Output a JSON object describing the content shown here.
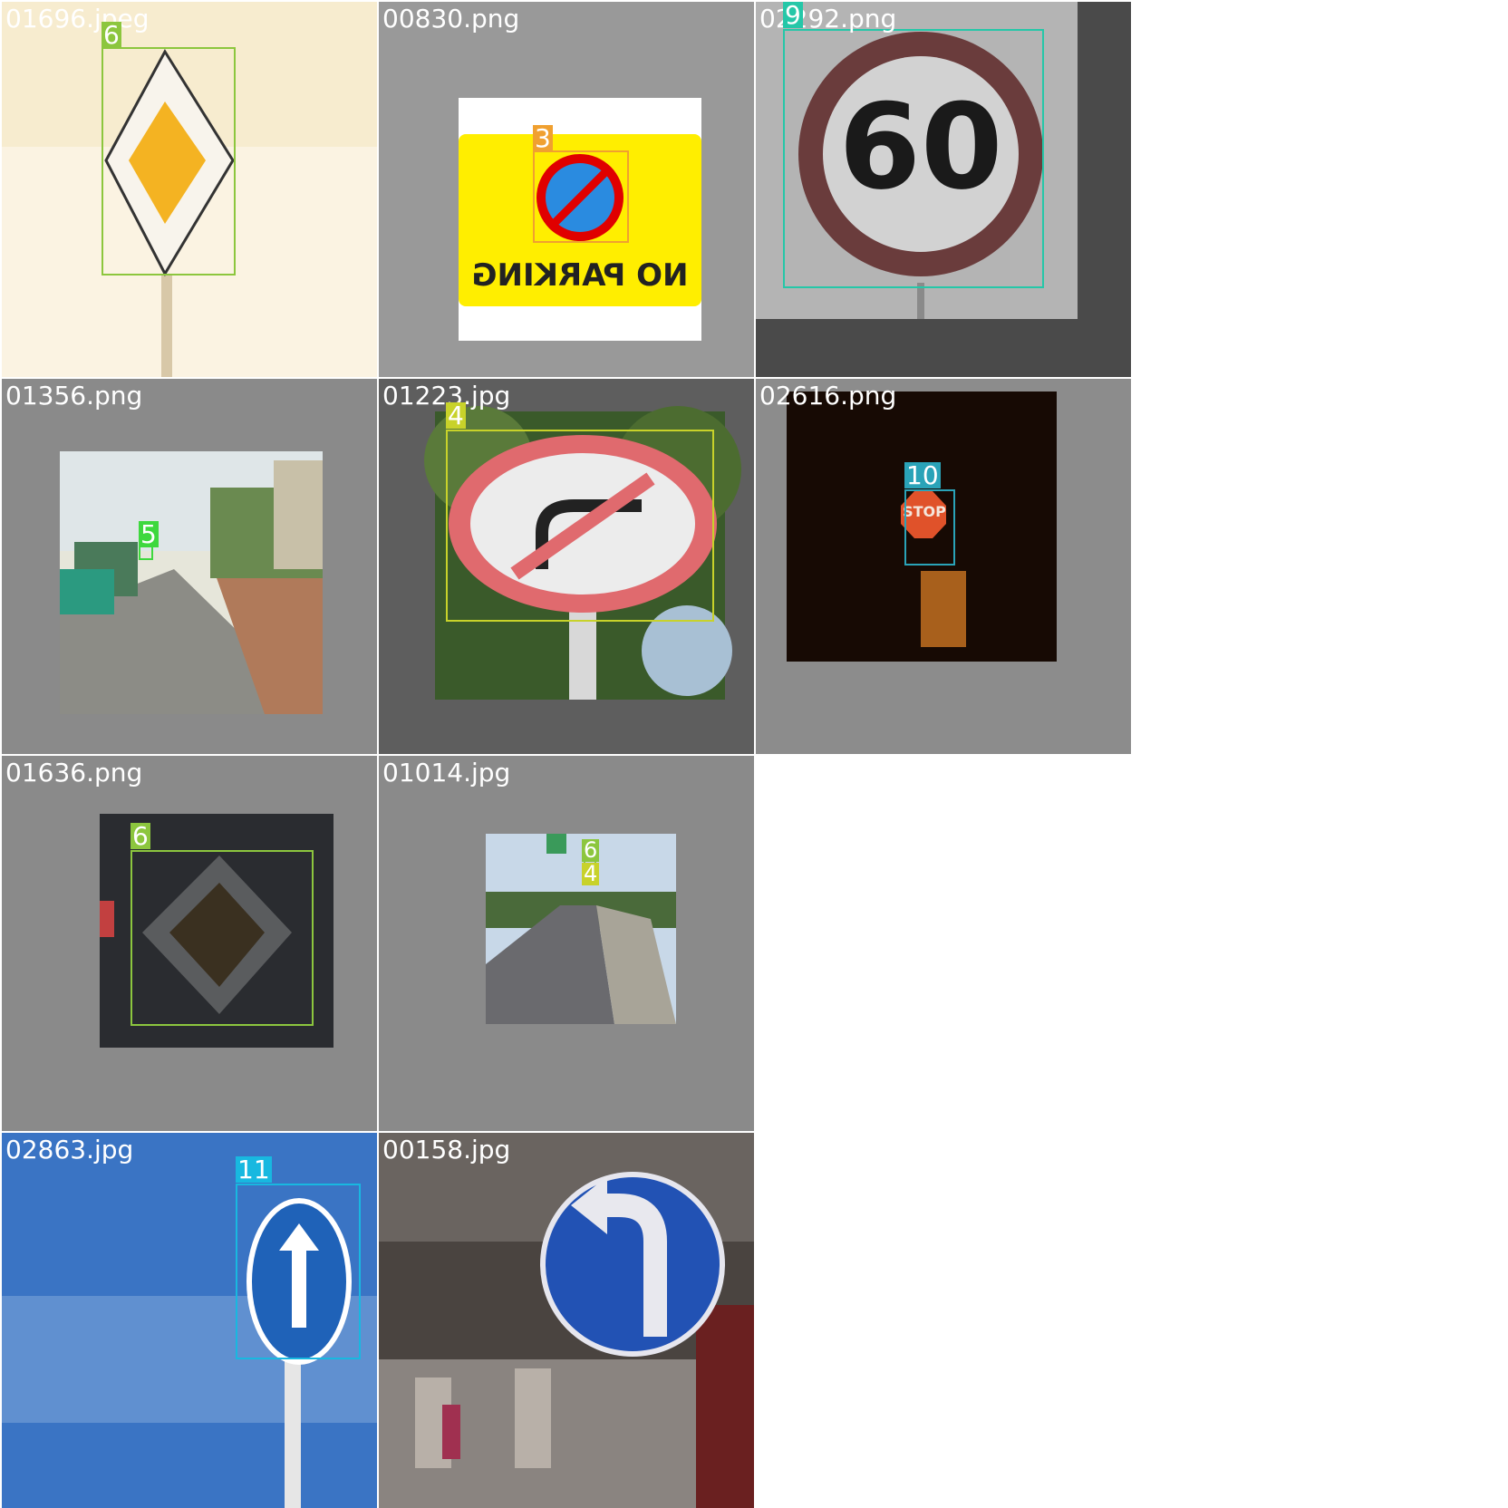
{
  "tiles": [
    {
      "filename": "01696.jpeg",
      "labels": [
        "6"
      ]
    },
    {
      "filename": "00830.png",
      "labels": [
        "3"
      ],
      "sign_text": "NO PARKING"
    },
    {
      "filename": "02292.png",
      "labels": [
        "9"
      ],
      "sign_text": "60"
    },
    {
      "filename": "01356.png",
      "labels": [
        "5"
      ]
    },
    {
      "filename": "01223.jpg",
      "labels": [
        "4"
      ]
    },
    {
      "filename": "02616.png",
      "labels": [
        "10"
      ],
      "sign_text": "STOP"
    },
    {
      "filename": "01636.png",
      "labels": [
        "6"
      ]
    },
    {
      "filename": "01014.jpg",
      "labels": [
        "6",
        "4"
      ]
    },
    {
      "filename": "02863.jpg",
      "labels": [
        "11"
      ]
    },
    {
      "filename": "00158.jpg",
      "labels": []
    }
  ],
  "colors": {
    "class_3": "#f0a030",
    "class_4": "#c8d22a",
    "class_5": "#3ed83e",
    "class_6": "#8cc63e",
    "class_9": "#25c7a8",
    "class_10": "#2aa3b8",
    "class_11": "#18b8e0"
  }
}
